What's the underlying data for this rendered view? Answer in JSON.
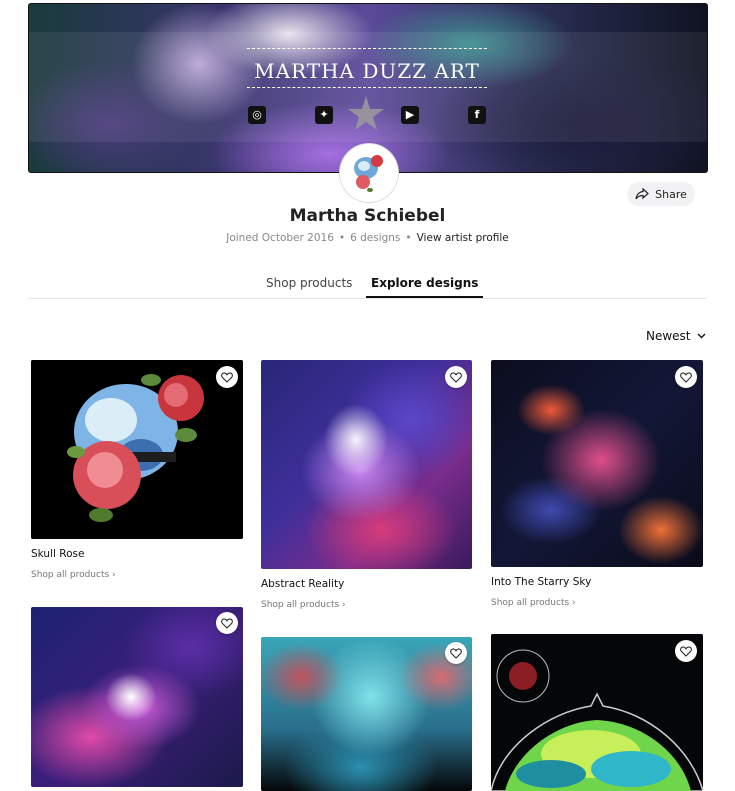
{
  "banner": {
    "title": "MARTHA DUZZ ART",
    "social": [
      {
        "name": "instagram",
        "glyph": "◎"
      },
      {
        "name": "twitter",
        "glyph": "✦"
      },
      {
        "name": "youtube",
        "glyph": "▶"
      },
      {
        "name": "facebook",
        "glyph": "f"
      }
    ]
  },
  "header": {
    "share_label": "Share",
    "artist_name": "Martha Schiebel",
    "joined": "Joined October 2016",
    "designs_count": "6 designs",
    "profile_link": "View artist profile"
  },
  "tabs": [
    {
      "label": "Shop products",
      "active": false
    },
    {
      "label": "Explore designs",
      "active": true
    }
  ],
  "sort": {
    "label": "Newest"
  },
  "designs": [
    {
      "title": "Skull Rose",
      "shop_label": "Shop all products"
    },
    {
      "title": "Abstract Reality",
      "shop_label": "Shop all products"
    },
    {
      "title": "Into The Starry Sky",
      "shop_label": "Shop all products"
    },
    {
      "title": "",
      "shop_label": ""
    },
    {
      "title": "",
      "shop_label": ""
    },
    {
      "title": "",
      "shop_label": ""
    }
  ]
}
